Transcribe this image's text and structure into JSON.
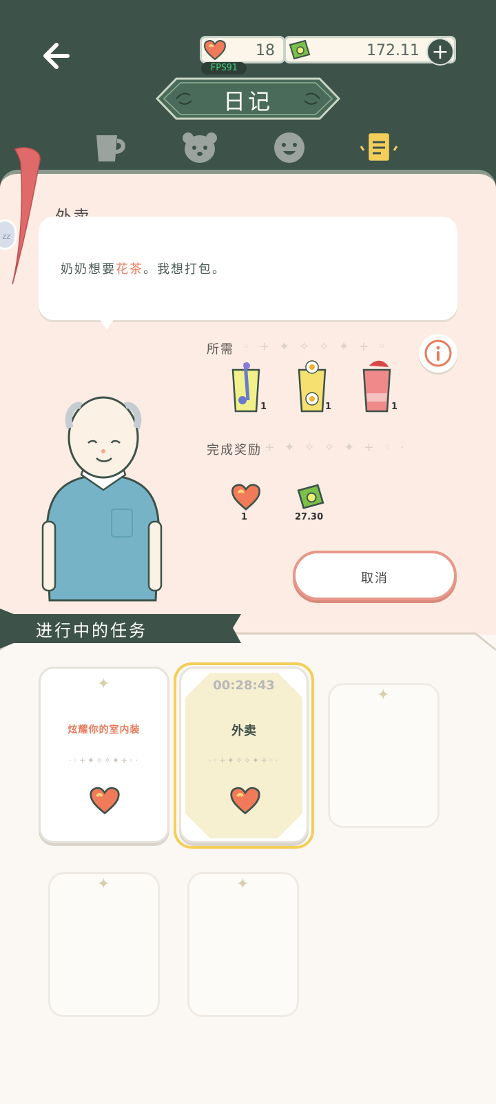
{
  "header": {
    "title": "日记",
    "hearts": "18",
    "money": "172.11",
    "fps": "FPS91"
  },
  "order": {
    "section_title": "外卖",
    "message_pre": "奶奶想要",
    "message_highlight": "花茶",
    "message_post": "。我想打包。",
    "required_label": "所需",
    "required_items": [
      {
        "name": "lavender-tea",
        "qty": "1"
      },
      {
        "name": "chamomile-tea",
        "qty": "1"
      },
      {
        "name": "berry-tea",
        "qty": "1"
      }
    ],
    "reward_label": "完成奖励",
    "rewards": [
      {
        "name": "heart",
        "qty": "1"
      },
      {
        "name": "cash",
        "qty": "27.30"
      }
    ],
    "cancel_label": "取消"
  },
  "tasks": {
    "banner_label": "进行中的任务",
    "cards": [
      {
        "title": "炫耀你的室内装"
      },
      {
        "title": "外卖",
        "timer": "00:28:43"
      }
    ]
  },
  "colors": {
    "dark_green": "#3d5249",
    "accent_orange": "#e87b5c",
    "paper": "#fcece4",
    "cancel_border": "#e79888",
    "highlight_gold": "#f3cf5a"
  }
}
